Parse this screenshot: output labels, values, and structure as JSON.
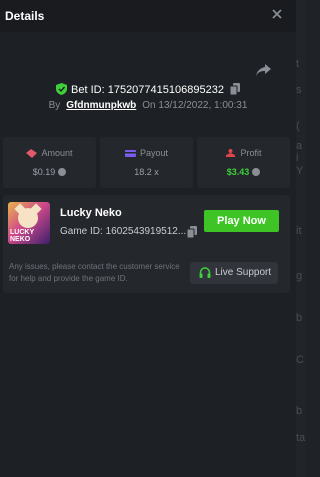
{
  "header": {
    "title": "Details"
  },
  "bet": {
    "id_text": "Bet ID: 1752077415106895232",
    "by_label": "By",
    "username": "Gfdnmunpkwb",
    "on_label": "On",
    "datetime": "13/12/2022, 1:00:31"
  },
  "stats": [
    {
      "label": "Amount",
      "value": "$0.19"
    },
    {
      "label": "Payout",
      "value": "18.2 x"
    },
    {
      "label": "Profit",
      "value": "$3.43"
    }
  ],
  "game": {
    "thumbnail_text": "LUCKY NEKO",
    "name": "Lucky Neko",
    "id_text": "Game ID: 1602543919512...",
    "play_label": "Play Now",
    "help_text": "Any issues, please contact the customer service for help and provide the game ID.",
    "support_label": "Live Support"
  },
  "backdrop_fragments": [
    "t",
    "s",
    "(",
    "a",
    "i",
    "Y",
    "it",
    "g",
    "b",
    "C",
    "b",
    "ta"
  ],
  "colors": {
    "accent_green": "#3fc426",
    "profit_green": "#3fcf3a",
    "amount_icon": "#e05a6a",
    "payout_icon": "#7b5cf0",
    "profit_icon": "#e0434a"
  },
  "icons": {
    "close": "close-icon",
    "share": "share-icon",
    "shield": "shield-check-icon",
    "copy": "copy-icon",
    "amount": "ticket-icon",
    "payout": "card-icon",
    "profit": "chart-icon",
    "support": "headset-icon"
  }
}
